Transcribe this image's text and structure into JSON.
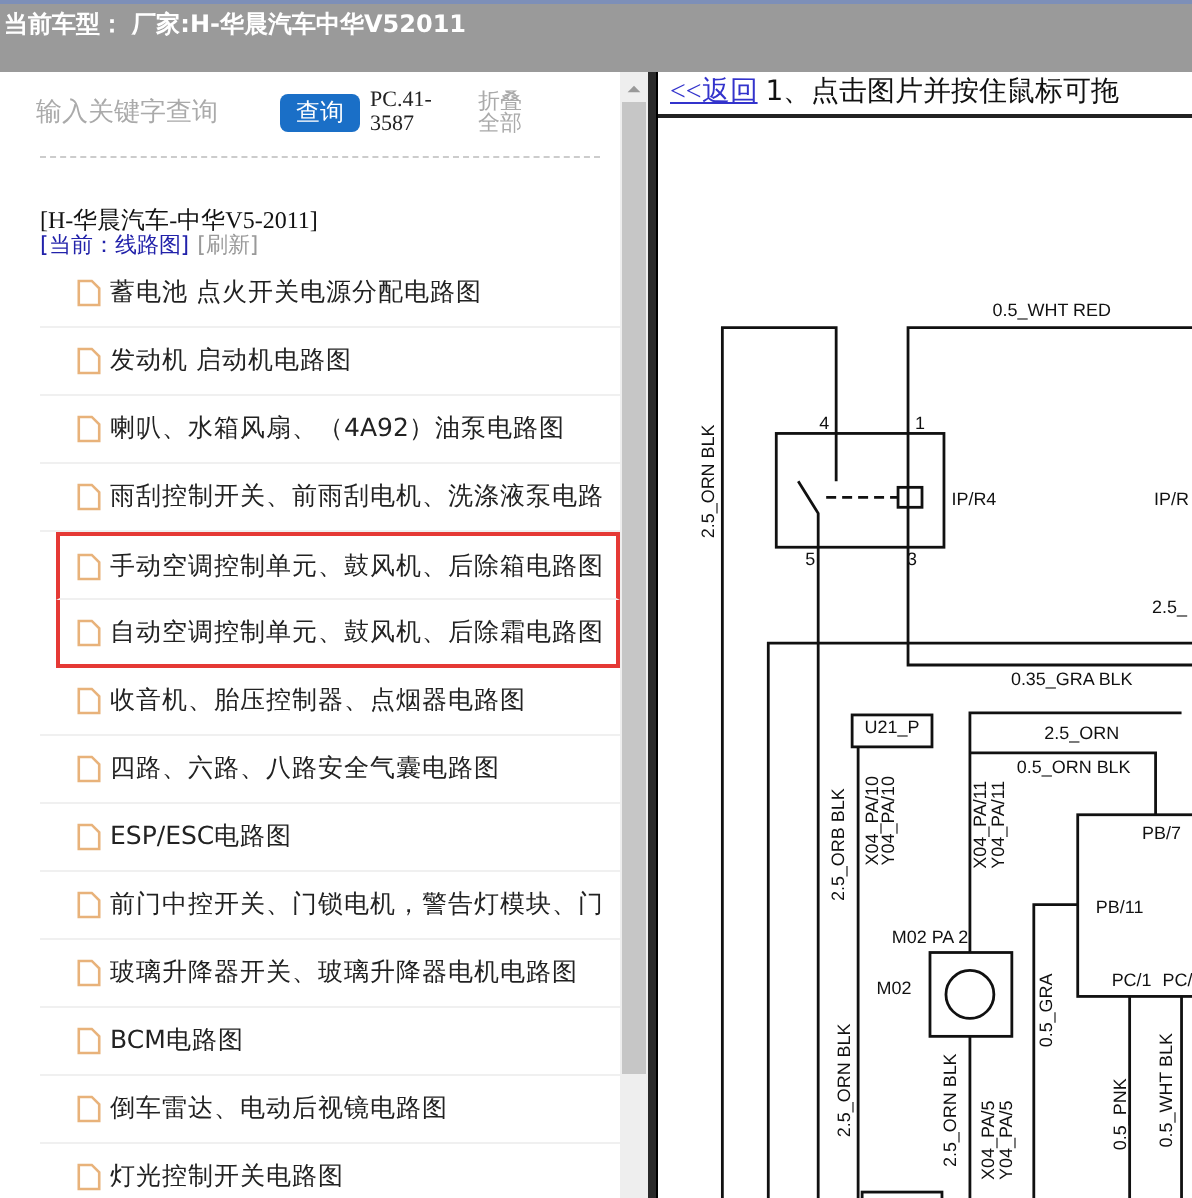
{
  "header": {
    "title": "当前车型： 厂家:H-华晨汽车中华V52011"
  },
  "sidebar": {
    "search": {
      "placeholder": "输入关键字查询"
    },
    "search_button": "查询",
    "code": "PC.41-3587",
    "collapse_link": "折叠全部",
    "model": "[H-华晨汽车-中华V5-2011]",
    "current": "[当前：线路图]",
    "refresh": "[刷新]",
    "items": [
      {
        "label": "蓄电池 点火开关电源分配电路图",
        "highlighted": false
      },
      {
        "label": "发动机 启动机电路图",
        "highlighted": false
      },
      {
        "label": "喇叭、水箱风扇、（4A92）油泵电路图",
        "highlighted": false
      },
      {
        "label": "雨刮控制开关、前雨刮电机、洗涤液泵电路",
        "highlighted": false
      },
      {
        "label": "手动空调控制单元、鼓风机、后除箱电路图",
        "highlighted": true
      },
      {
        "label": "自动空调控制单元、鼓风机、后除霜电路图",
        "highlighted": true
      },
      {
        "label": "收音机、胎压控制器、点烟器电路图",
        "highlighted": false
      },
      {
        "label": "四路、六路、八路安全气囊电路图",
        "highlighted": false
      },
      {
        "label": "ESP/ESC电路图",
        "highlighted": false
      },
      {
        "label": "前门中控开关、门锁电机，警告灯模块、门",
        "highlighted": false
      },
      {
        "label": "玻璃升降器开关、玻璃升降器电机电路图",
        "highlighted": false
      },
      {
        "label": "BCM电路图",
        "highlighted": false
      },
      {
        "label": "倒车雷达、电动后视镜电路图",
        "highlighted": false
      },
      {
        "label": "灯光控制开关电路图",
        "highlighted": false
      }
    ]
  },
  "viewer": {
    "back_link": "<<返回",
    "hint": "1、点击图片并按住鼠标可拖",
    "diagram_labels": [
      {
        "text": "0.5_WHT RED",
        "kind": "h"
      },
      {
        "text": "2.5_ORN BLK",
        "kind": "v"
      },
      {
        "text": "4",
        "kind": "h"
      },
      {
        "text": "1",
        "kind": "h"
      },
      {
        "text": "IP/R4",
        "kind": "h"
      },
      {
        "text": "IP/R",
        "kind": "h"
      },
      {
        "text": "5",
        "kind": "h"
      },
      {
        "text": "3",
        "kind": "h"
      },
      {
        "text": "2.5_",
        "kind": "h"
      },
      {
        "text": "0.35_GRA BLK",
        "kind": "h"
      },
      {
        "text": "U21_P",
        "kind": "h"
      },
      {
        "text": "2.5_ORN",
        "kind": "h"
      },
      {
        "text": "0.5_ORN BLK",
        "kind": "h"
      },
      {
        "text": "2.5_ORB BLK",
        "kind": "v"
      },
      {
        "text": "X04_PA/10",
        "kind": "v"
      },
      {
        "text": "Y04_PA/10",
        "kind": "v"
      },
      {
        "text": "X04_PA/11",
        "kind": "v"
      },
      {
        "text": "Y04_PA/11",
        "kind": "v"
      },
      {
        "text": "PB/7",
        "kind": "h"
      },
      {
        "text": "PB/11",
        "kind": "h"
      },
      {
        "text": "M02 PA 2",
        "kind": "h"
      },
      {
        "text": "M02",
        "kind": "h"
      },
      {
        "text": "PC/1",
        "kind": "h"
      },
      {
        "text": "PC/",
        "kind": "h"
      },
      {
        "text": "2.5_ORN BLK",
        "kind": "v"
      },
      {
        "text": "2.5_ORN BLK",
        "kind": "v"
      },
      {
        "text": "0.5_GRA",
        "kind": "v"
      },
      {
        "text": "X04_PA/5",
        "kind": "v"
      },
      {
        "text": "Y04_PA/5",
        "kind": "v"
      },
      {
        "text": "0.5_PNK",
        "kind": "v"
      },
      {
        "text": "0.5_WHT BLK",
        "kind": "v"
      }
    ]
  }
}
